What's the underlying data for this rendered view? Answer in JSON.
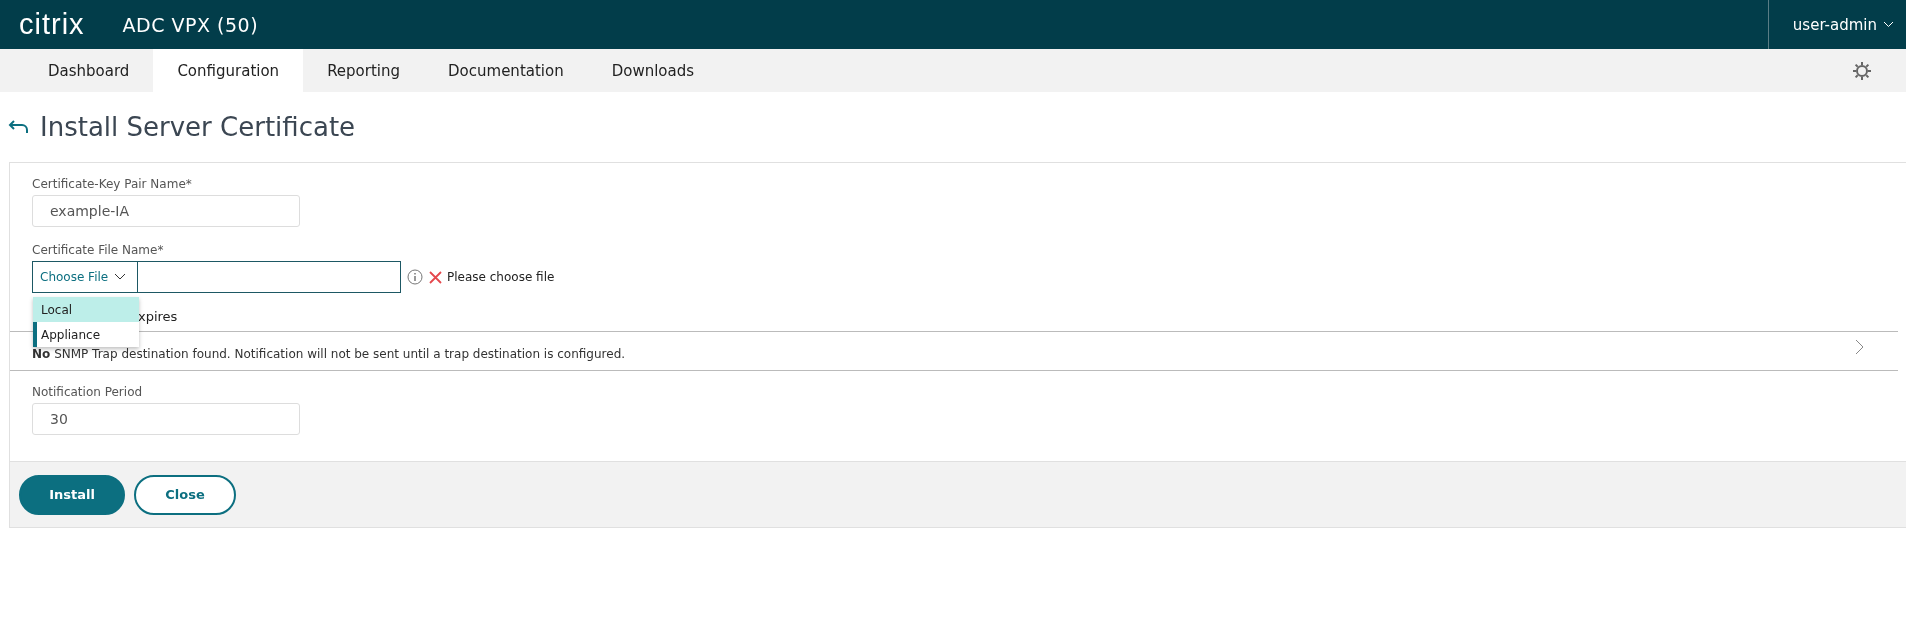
{
  "header": {
    "logo": "citrix",
    "product": "ADC VPX (50)",
    "user": "user-admin"
  },
  "tabs": [
    {
      "label": "Dashboard",
      "selected": false
    },
    {
      "label": "Configuration",
      "selected": true
    },
    {
      "label": "Reporting",
      "selected": false
    },
    {
      "label": "Documentation",
      "selected": false
    },
    {
      "label": "Downloads",
      "selected": false
    }
  ],
  "page_title": "Install Server Certificate",
  "form": {
    "key_pair_label": "Certificate-Key Pair Name*",
    "key_pair_value": "example-IA",
    "file_label": "Certificate File Name*",
    "choose_file": "Choose File",
    "error": "Please choose file",
    "dropdown": [
      {
        "label": "Local",
        "selected": true
      },
      {
        "label": "Appliance",
        "selected": false
      }
    ],
    "notify_partial": "xpires",
    "snmp_bold": "No",
    "snmp_text": "SNMP Trap destination found. Notification will not be sent until a trap destination is configured.",
    "period_label": "Notification Period",
    "period_value": "30"
  },
  "buttons": [
    {
      "label": "Install",
      "kind": "primary"
    },
    {
      "label": "Close",
      "kind": "secondary"
    }
  ]
}
